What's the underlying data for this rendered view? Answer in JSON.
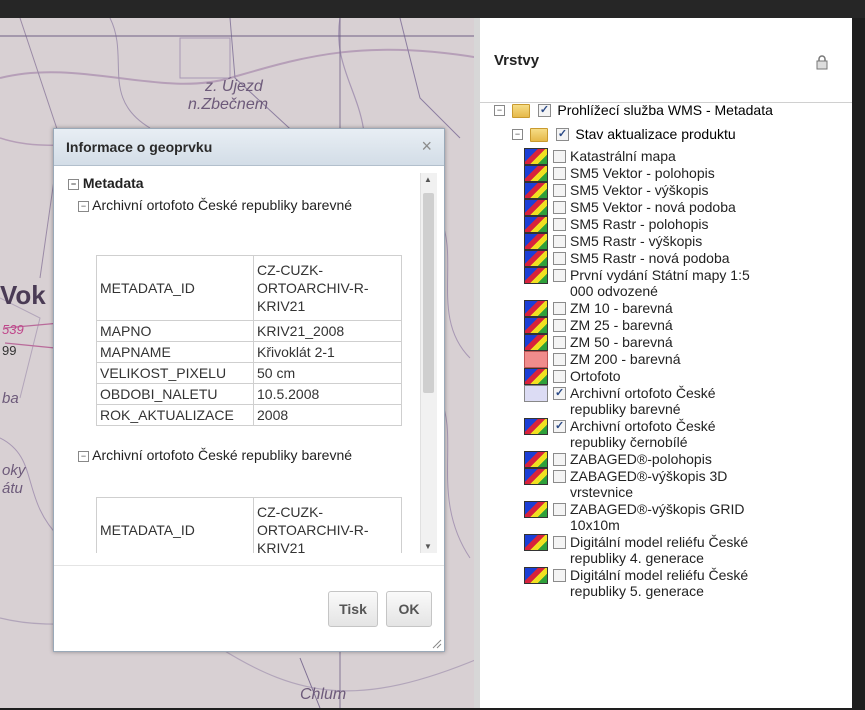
{
  "map": {
    "labels": [
      "z. Újezd",
      "n.Zbečnem",
      "Chlum",
      "Vok",
      "539",
      "99",
      "ba",
      "oky",
      "átu"
    ]
  },
  "layers_panel": {
    "title": "Vrstvy",
    "root": {
      "label": "Prohlížecí služba WMS - Metadata",
      "checked": true
    },
    "group": {
      "label": "Stav aktualizace produktu",
      "checked": true
    },
    "items": [
      {
        "lines": [
          "Katastrální mapa"
        ],
        "checked": false,
        "legend": "multi"
      },
      {
        "lines": [
          "SM5 Vektor - polohopis"
        ],
        "checked": false,
        "legend": "multi"
      },
      {
        "lines": [
          "SM5 Vektor - výškopis"
        ],
        "checked": false,
        "legend": "multi"
      },
      {
        "lines": [
          "SM5 Vektor - nová podoba"
        ],
        "checked": false,
        "legend": "multi"
      },
      {
        "lines": [
          "SM5 Rastr - polohopis"
        ],
        "checked": false,
        "legend": "multi"
      },
      {
        "lines": [
          "SM5 Rastr - výškopis"
        ],
        "checked": false,
        "legend": "multi"
      },
      {
        "lines": [
          "SM5 Rastr - nová podoba"
        ],
        "checked": false,
        "legend": "multi"
      },
      {
        "lines": [
          "První vydání Státní mapy 1:5",
          "000 odvozené"
        ],
        "checked": false,
        "legend": "multi"
      },
      {
        "lines": [
          "ZM 10 - barevná"
        ],
        "checked": false,
        "legend": "multi"
      },
      {
        "lines": [
          "ZM 25 - barevná"
        ],
        "checked": false,
        "legend": "multi"
      },
      {
        "lines": [
          "ZM 50 - barevná"
        ],
        "checked": false,
        "legend": "multi"
      },
      {
        "lines": [
          "ZM 200 - barevná"
        ],
        "checked": false,
        "legend": "pink"
      },
      {
        "lines": [
          "Ortofoto"
        ],
        "checked": false,
        "legend": "multi"
      },
      {
        "lines": [
          "Archivní ortofoto České",
          "republiky barevné"
        ],
        "checked": true,
        "legend": "lavender"
      },
      {
        "lines": [
          "Archivní ortofoto České",
          "republiky černobílé"
        ],
        "checked": true,
        "legend": "multi"
      },
      {
        "lines": [
          "ZABAGED®-polohopis"
        ],
        "checked": false,
        "legend": "multi"
      },
      {
        "lines": [
          "ZABAGED®-výškopis 3D",
          "vrstevnice"
        ],
        "checked": false,
        "legend": "multi"
      },
      {
        "lines": [
          "ZABAGED®-výškopis GRID",
          "10x10m"
        ],
        "checked": false,
        "legend": "multi"
      },
      {
        "lines": [
          "Digitální model reliéfu České",
          "republiky 4. generace"
        ],
        "checked": false,
        "legend": "multi"
      },
      {
        "lines": [
          "Digitální model reliéfu České",
          "republiky 5. generace"
        ],
        "checked": false,
        "legend": "multi"
      }
    ]
  },
  "dialog": {
    "title": "Informace o geoprvku",
    "close_label": "×",
    "section": "Metadata",
    "records": [
      {
        "title": "Archivní ortofoto České republiky barevné",
        "rows": [
          {
            "key": "METADATA_ID",
            "value": "CZ-CUZK-ORTOARCHIV-R-KRIV21"
          },
          {
            "key": "MAPNO",
            "value": "KRIV21_2008"
          },
          {
            "key": "MAPNAME",
            "value": "Křivoklát 2-1"
          },
          {
            "key": "VELIKOST_PIXELU",
            "value": "50 cm"
          },
          {
            "key": "OBDOBI_NALETU",
            "value": "10.5.2008"
          },
          {
            "key": "ROK_AKTUALIZACE",
            "value": "2008"
          }
        ]
      },
      {
        "title": "Archivní ortofoto České republiky barevné",
        "rows": [
          {
            "key": "METADATA_ID",
            "value": "CZ-CUZK-ORTOARCHIV-R-KRIV21"
          }
        ]
      }
    ],
    "buttons": {
      "print": "Tisk",
      "ok": "OK"
    }
  }
}
